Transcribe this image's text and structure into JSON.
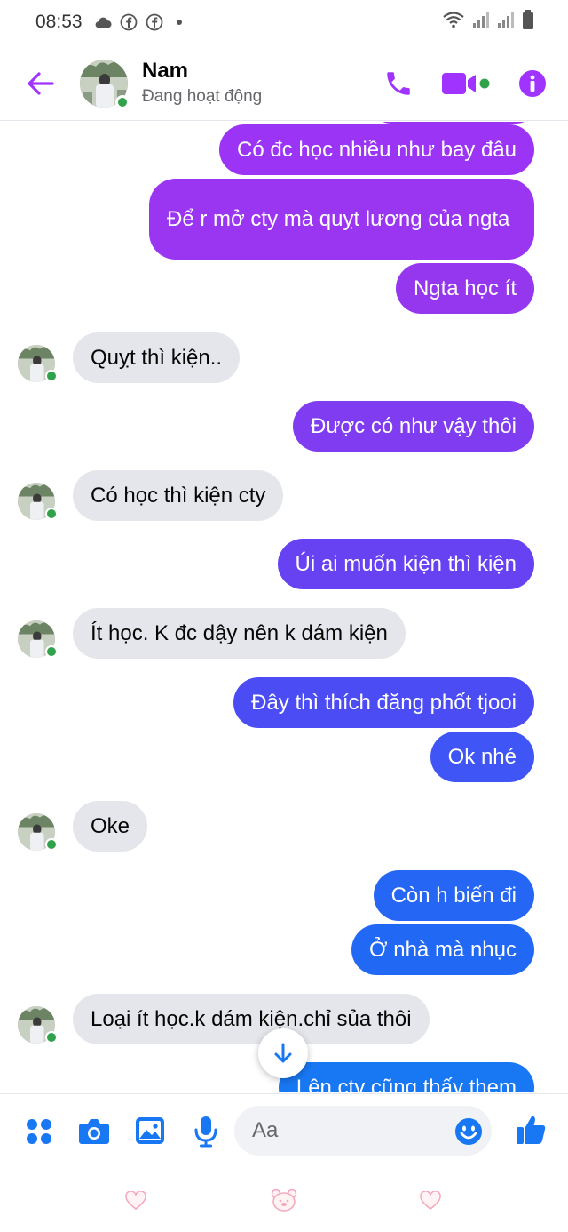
{
  "status_bar": {
    "time": "08:53",
    "icons": [
      "cloud-icon",
      "facebook-icon",
      "facebook-icon",
      "dot-icon",
      "wifi-icon",
      "signal-icon",
      "signal-icon",
      "battery-icon"
    ]
  },
  "header": {
    "name": "Nam",
    "status": "Đang hoạt động",
    "icons": [
      "back-arrow-icon",
      "phone-icon",
      "video-camera-icon",
      "info-icon"
    ],
    "accent_color": "#a033ff"
  },
  "messages": [
    {
      "dir": "out",
      "text": "Có đc học nhiều như bay đâu",
      "color": "#9b34f4"
    },
    {
      "dir": "out",
      "text": "Để r mở cty mà quỵt lương của ngta",
      "color": "#9a35f2"
    },
    {
      "dir": "out",
      "text": "Ngta học ít",
      "color": "#9637f0"
    },
    {
      "dir": "in",
      "text": "Quỵt thì kiện.."
    },
    {
      "dir": "out",
      "text": "Được có như vậy thôi",
      "color": "#7f3cf0"
    },
    {
      "dir": "in",
      "text": "Có học thì kiện cty"
    },
    {
      "dir": "out",
      "text": "Úi ai muốn kiện thì kiện",
      "color": "#6642f2"
    },
    {
      "dir": "in",
      "text": "Ít học. K đc dậy nên k dám kiện"
    },
    {
      "dir": "out",
      "text": "Đây thì thích đăng phốt tjooi",
      "color": "#4b4cf4"
    },
    {
      "dir": "out",
      "text": "Ok nhé",
      "color": "#3f55f5"
    },
    {
      "dir": "in",
      "text": "Oke"
    },
    {
      "dir": "out",
      "text": "Còn h biến đi",
      "color": "#2566f5"
    },
    {
      "dir": "out",
      "text": "Ở nhà mà nhục",
      "color": "#2169f5"
    },
    {
      "dir": "in",
      "text": "Loại ít học.k dám kiện.chỉ sủa thôi"
    },
    {
      "dir": "out",
      "text": "Lên cty cũng thấy them",
      "color": "#1877f2"
    }
  ],
  "composer": {
    "placeholder": "Aa",
    "icons": [
      "menu-dots-icon",
      "camera-icon",
      "image-icon",
      "microphone-icon",
      "emoji-icon",
      "thumbs-up-icon"
    ],
    "accent_color": "#1877f2"
  },
  "scroll_button": {
    "icon": "arrow-down-icon"
  },
  "bottom_bar": {
    "icons": [
      "heart-icon",
      "bear-icon",
      "heart-icon"
    ]
  }
}
